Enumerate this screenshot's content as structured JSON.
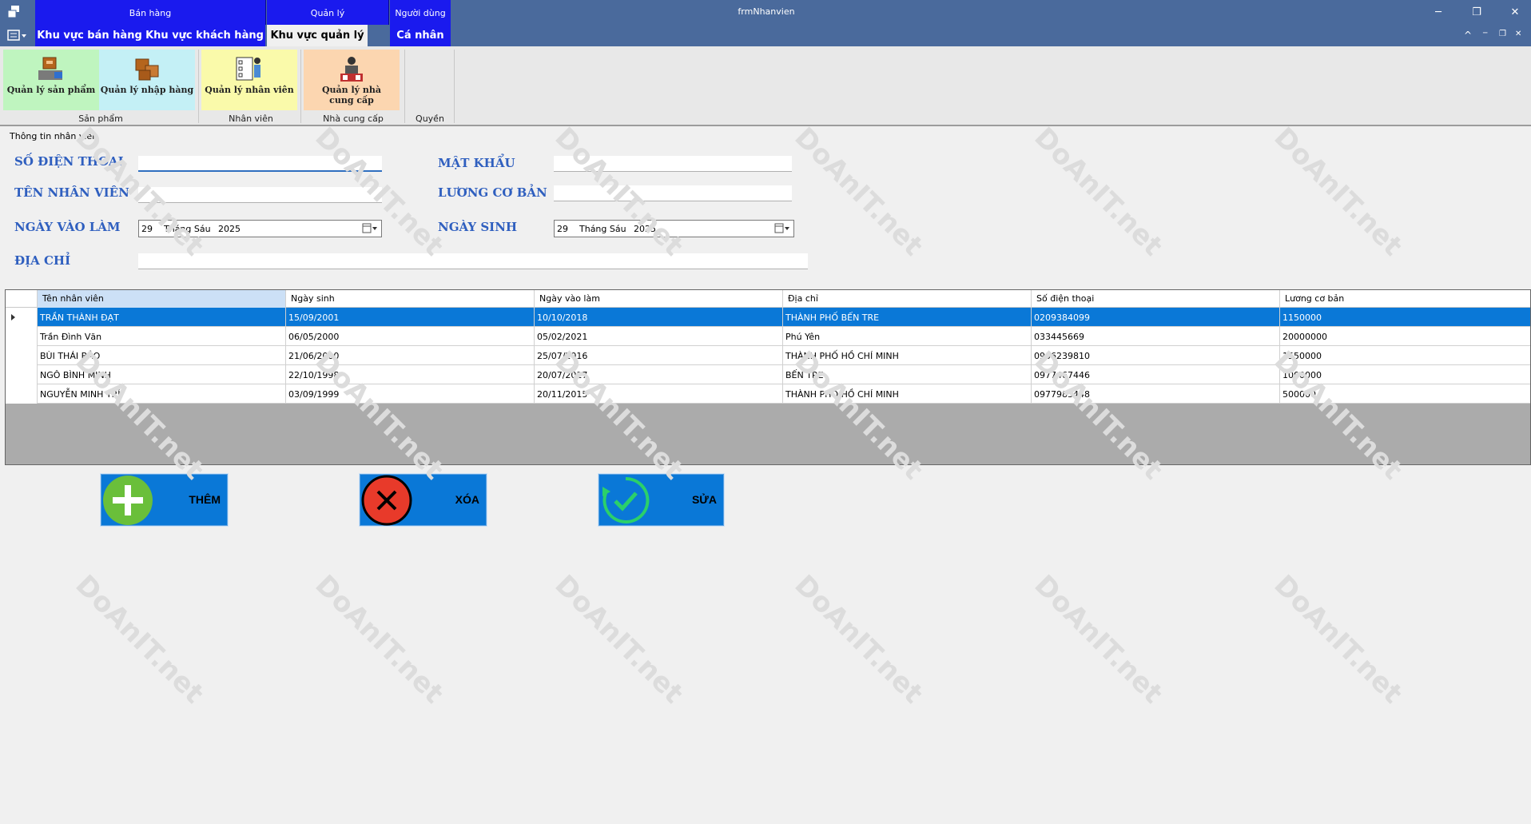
{
  "window": {
    "title": "frmNhanvien",
    "minimize": "─",
    "restore": "❐",
    "close": "✕"
  },
  "ribbon_categories": [
    "Bán hàng",
    "Quản lý",
    "Người dùng"
  ],
  "ribbon_tabs": [
    "Khu vực bán hàng",
    "Khu vực khách hàng",
    "Khu vực quản lý",
    "Cá nhân"
  ],
  "ribbon_mini": {
    "collapse": "^",
    "min": "─",
    "restore": "❐",
    "close": "✕"
  },
  "ribbon_buttons": {
    "product": "Quản lý sản phẩm",
    "import": "Quản lý nhập hàng",
    "employee": "Quản lý nhân viên",
    "supplier_line1": "Quản lý nhà",
    "supplier_line2": "cung cấp"
  },
  "ribbon_groups": [
    "Sản phẩm",
    "Nhân viên",
    "Nhà cung cấp",
    "Quyền"
  ],
  "form": {
    "group_title": "Thông tin nhân viên",
    "phone_label": "SỐ ĐIỆN THOẠI",
    "password_label": "MẬT KHẨU",
    "name_label": "TÊN NHÂN VIÊN",
    "salary_label": "LƯƠNG CƠ BẢN",
    "join_date_label": "NGÀY VÀO LÀM",
    "birth_date_label": "NGÀY SINH",
    "address_label": "ĐỊA CHỈ",
    "phone_value": "",
    "password_value": "",
    "name_value": "",
    "salary_value": "",
    "address_value": "",
    "join_date": {
      "day": "29",
      "month": "Tháng Sáu",
      "year": "2025"
    },
    "birth_date": {
      "day": "29",
      "month": "Tháng Sáu",
      "year": "2025"
    }
  },
  "grid": {
    "columns": [
      "Tên nhân viên",
      "Ngày sinh",
      "Ngày vào làm",
      "Địa chỉ",
      "Số điện thoại",
      "Lương cơ bản"
    ],
    "rows": [
      [
        "TRẦN THÀNH ĐẠT",
        "15/09/2001",
        "10/10/2018",
        "THÀNH PHỐ BẾN TRE",
        "0209384099",
        "1150000"
      ],
      [
        "Trần Đình Văn",
        "06/05/2000",
        "05/02/2021",
        "Phú Yên",
        "033445669",
        "20000000"
      ],
      [
        "BÙI THÁI BẢO",
        "21/06/2000",
        "25/07/2016",
        "THÀNH PHỐ HỒ CHÍ MINH",
        "0906239810",
        "1550000"
      ],
      [
        "NGÔ BÌNH MINH",
        "22/10/1998",
        "20/07/2017",
        "BẾN TRE",
        "0977467446",
        "1000000"
      ],
      [
        "NGUYỄN MINH TRÍ",
        "03/09/1999",
        "20/11/2015",
        "THÀNH PHỐ HỒ CHÍ MINH",
        "0977983448",
        "500000"
      ]
    ],
    "selected_row": 0
  },
  "actions": {
    "add": "THÊM",
    "delete": "XÓA",
    "edit": "SỬA"
  },
  "watermark": {
    "text": "DoAnIT.net"
  },
  "colors": {
    "accent_blue": "#1a1aee",
    "title_bar": "#4a6a9c",
    "selection": "#0a78d7",
    "label_blue": "#2f5fbf"
  }
}
